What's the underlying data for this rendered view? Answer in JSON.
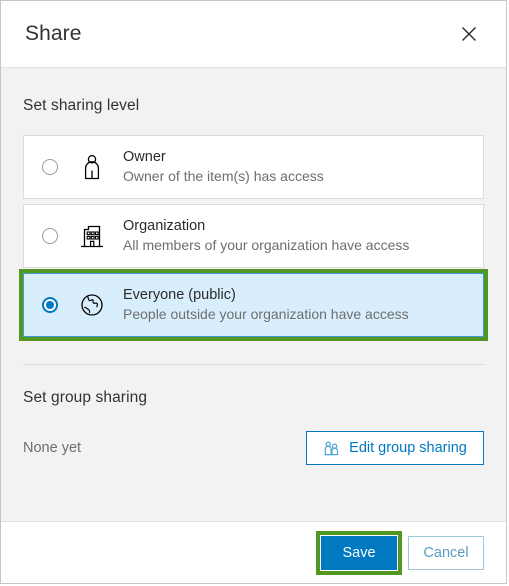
{
  "dialog": {
    "title": "Share",
    "close_icon": "close-icon"
  },
  "sharing_level": {
    "heading": "Set sharing level",
    "options": [
      {
        "label": "Owner",
        "description": "Owner of the item(s) has access",
        "icon": "person-icon",
        "selected": false
      },
      {
        "label": "Organization",
        "description": "All members of your organization have access",
        "icon": "building-icon",
        "selected": false
      },
      {
        "label": "Everyone (public)",
        "description": "People outside your organization have access",
        "icon": "globe-icon",
        "selected": true
      }
    ]
  },
  "group_sharing": {
    "heading": "Set group sharing",
    "status": "None yet",
    "edit_button_label": "Edit group sharing",
    "edit_button_icon": "group-people-icon"
  },
  "footer": {
    "save_label": "Save",
    "cancel_label": "Cancel"
  },
  "colors": {
    "accent_blue": "#0079c1",
    "highlight_green": "#519722",
    "selected_row_bg": "#d9eefc",
    "body_bg": "#f2f2f2"
  }
}
